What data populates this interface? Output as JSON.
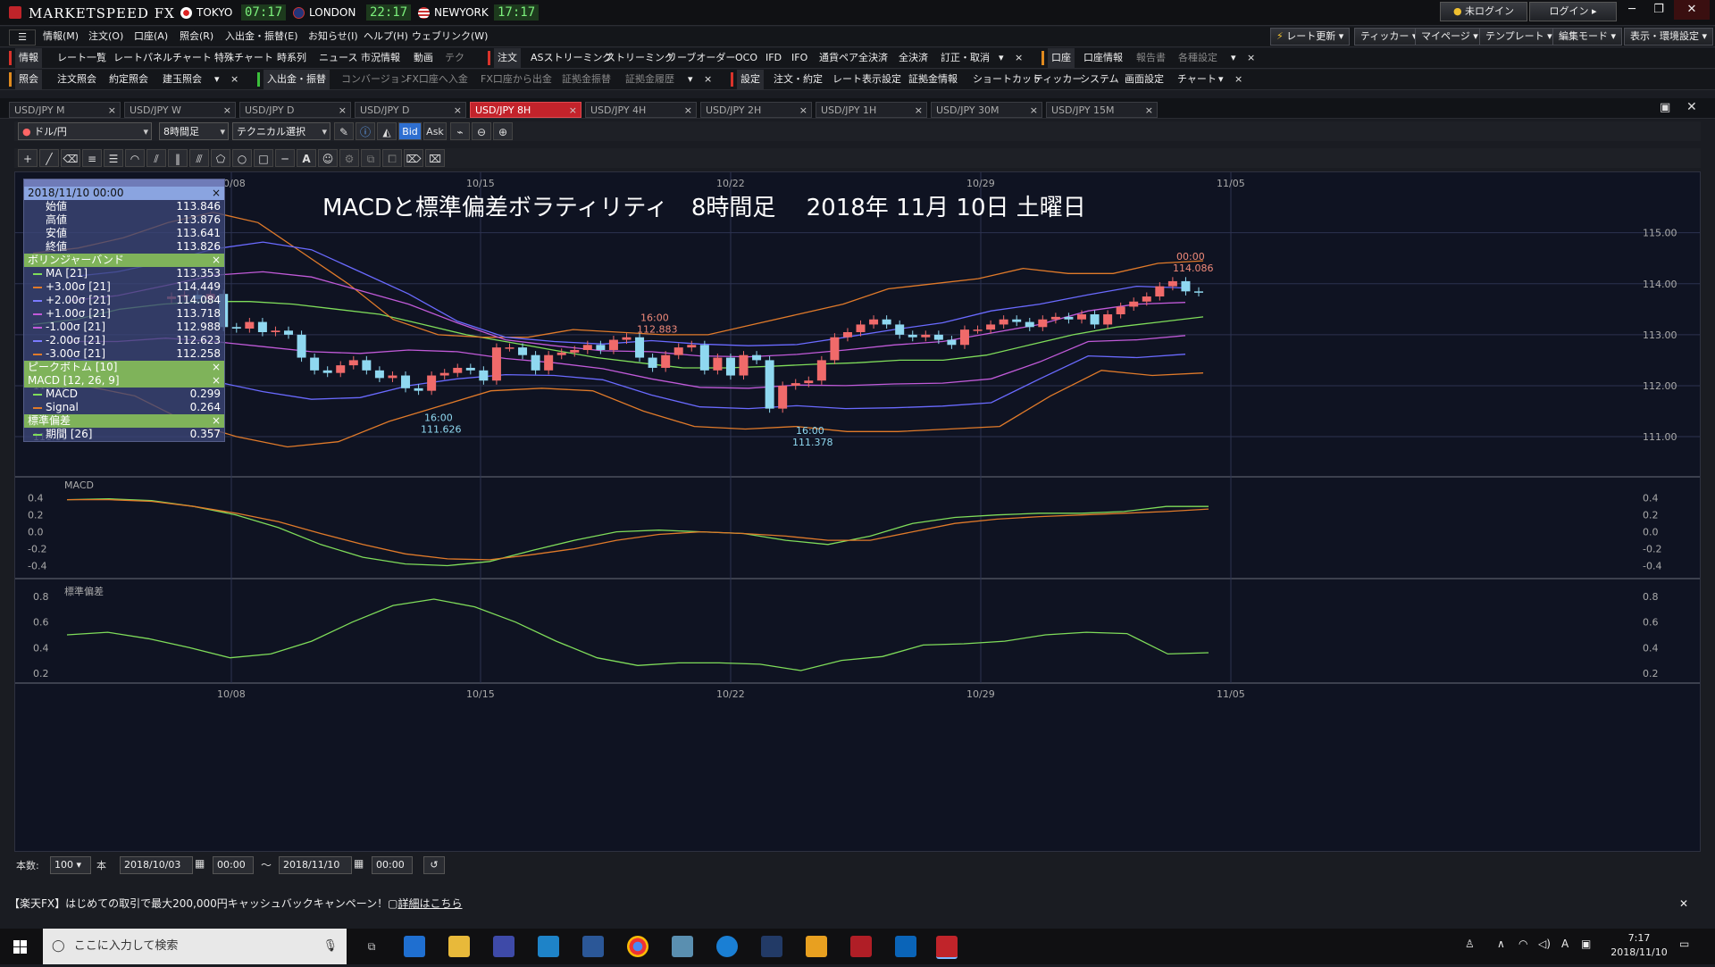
{
  "app": {
    "title": "MARKETSPEED FX"
  },
  "clocks": [
    {
      "city": "TOKYO",
      "time": "07:17"
    },
    {
      "city": "LONDON",
      "time": "22:17"
    },
    {
      "city": "NEWYORK",
      "time": "17:17"
    }
  ],
  "titlebar_right": {
    "login_status": "未ログイン",
    "login_button": "ログイン"
  },
  "menu_main": [
    "情報(M)",
    "注文(O)",
    "口座(A)",
    "照会(R)",
    "入出金・振替(E)",
    "お知らせ(I)",
    "ヘルプ(H)",
    "ウェブリンク(W)"
  ],
  "menu_main_right": [
    "レート更新",
    "ティッカー",
    "マイページ",
    "テンプレート",
    "編集モード",
    "表示・環境設定"
  ],
  "toolbar_row1_info": [
    "情報",
    "レート一覧",
    "レートパネル",
    "チャート",
    "特殊チャート",
    "時系列",
    "ニュース",
    "市況情報",
    "動画",
    "テク"
  ],
  "toolbar_row1_order": [
    "注文",
    "ASストリーミング",
    "ストリーミング",
    "リーブオーダー",
    "OCO",
    "IFD",
    "IFO",
    "通貨ペア全決済",
    "全決済",
    "訂正・取消"
  ],
  "toolbar_row1_account": [
    "口座",
    "口座情報",
    "報告書",
    "各種設定"
  ],
  "toolbar_row2_inquiry": [
    "照会",
    "注文照会",
    "約定照会",
    "建玉照会"
  ],
  "toolbar_row2_transfer": [
    "入出金・振替",
    "コンバージョン",
    "FX口座へ入金",
    "FX口座から出金",
    "証拠金振替",
    "証拠金履歴"
  ],
  "toolbar_row2_settings": [
    "設定",
    "注文・約定",
    "レート表示設定",
    "証拠金情報",
    "ショートカット",
    "ティッカー",
    "システム",
    "画面設定",
    "チャート"
  ],
  "chart_tabs": [
    "USD/JPY M",
    "USD/JPY W",
    "USD/JPY D",
    "USD/JPY 8H",
    "USD/JPY 4H",
    "USD/JPY 2H",
    "USD/JPY 1H",
    "USD/JPY 30M",
    "USD/JPY 15M"
  ],
  "active_tab": "USD/JPY 8H",
  "chart_toolbar": {
    "pair": "ドル/円",
    "period": "8時間足",
    "technical": "テクニカル選択",
    "bid": "Bid",
    "ask": "Ask"
  },
  "info_panel": {
    "date": "2018/11/10 00:00",
    "ohlc": [
      {
        "label": "始値",
        "value": "113.846"
      },
      {
        "label": "高値",
        "value": "113.876"
      },
      {
        "label": "安値",
        "value": "113.641"
      },
      {
        "label": "終値",
        "value": "113.826"
      }
    ],
    "bollinger_header": "ボリンジャーバンド",
    "bollinger": [
      {
        "label": "MA [21]",
        "value": "113.353",
        "color": "#7fdc5a"
      },
      {
        "label": "+3.00σ [21]",
        "value": "114.449",
        "color": "#e07a2a"
      },
      {
        "label": "+2.00σ [21]",
        "value": "114.084",
        "color": "#7b7bff"
      },
      {
        "label": "+1.00σ [21]",
        "value": "113.718",
        "color": "#c05ad8"
      },
      {
        "label": "-1.00σ [21]",
        "value": "112.988",
        "color": "#c05ad8"
      },
      {
        "label": "-2.00σ [21]",
        "value": "112.623",
        "color": "#7b7bff"
      },
      {
        "label": "-3.00σ [21]",
        "value": "112.258",
        "color": "#e07a2a"
      }
    ],
    "peak_header": "ピークボトム [10]",
    "macd_header": "MACD [12, 26, 9]",
    "macd": [
      {
        "label": "MACD",
        "value": "0.299",
        "color": "#7fdc5a"
      },
      {
        "label": "Signal",
        "value": "0.264",
        "color": "#e07a2a"
      }
    ],
    "stdev_header": "標準偏差",
    "stdev": [
      {
        "label": "期間 [26]",
        "value": "0.357",
        "color": "#7fdc5a"
      }
    ],
    "close_glyph": "×"
  },
  "chart_title": "MACDと標準偏差ボラティリティ　8時間足　 2018年 11月 10日 土曜日",
  "chart_data": [
    {
      "type": "candlestick",
      "title": "MACDと標準偏差ボラティリティ　8時間足　 2018年 11月 10日 土曜日",
      "x_tick_labels": [
        "10/08",
        "10/15",
        "10/22",
        "10/29",
        "11/05"
      ],
      "y_tick_labels": [
        "115.00",
        "114.00",
        "113.00",
        "112.00",
        "111.00"
      ],
      "ylim": [
        110.3,
        115.8
      ],
      "annotations": [
        {
          "time": "16:00",
          "price": "111.626"
        },
        {
          "time": "16:00",
          "price": "112.883"
        },
        {
          "time": "16:00",
          "price": "111.378"
        },
        {
          "time": "00:00",
          "price": "114.086"
        }
      ],
      "candles_close": [
        113.75,
        113.78,
        113.7,
        113.8,
        113.15,
        113.12,
        113.25,
        113.05,
        113.08,
        113.0,
        112.55,
        112.3,
        112.25,
        112.4,
        112.5,
        112.3,
        112.15,
        112.2,
        111.95,
        111.9,
        112.2,
        112.25,
        112.35,
        112.3,
        112.1,
        112.75,
        112.75,
        112.6,
        112.3,
        112.6,
        112.65,
        112.7,
        112.8,
        112.7,
        112.9,
        112.95,
        112.55,
        112.35,
        112.6,
        112.75,
        112.8,
        112.3,
        112.55,
        112.2,
        112.6,
        112.5,
        111.55,
        112.0,
        112.05,
        112.1,
        112.5,
        112.95,
        113.05,
        113.2,
        113.3,
        113.2,
        113.0,
        112.95,
        113.0,
        112.9,
        112.8,
        113.1,
        113.1,
        113.2,
        113.3,
        113.25,
        113.15,
        113.3,
        113.35,
        113.3,
        113.4,
        113.2,
        113.4,
        113.55,
        113.65,
        113.75,
        113.95,
        114.05,
        113.85,
        113.83
      ],
      "series": [
        {
          "name": "MA [21]",
          "color": "#7fdc5a",
          "values": [
            113.2,
            113.3,
            113.5,
            113.6,
            113.65,
            113.65,
            113.6,
            113.5,
            113.4,
            113.2,
            113.0,
            112.85,
            112.7,
            112.55,
            112.45,
            112.35,
            112.35,
            112.38,
            112.42,
            112.45,
            112.5,
            112.5,
            112.6,
            112.8,
            113.0,
            113.15,
            113.25,
            113.35
          ]
        },
        {
          "name": "+3.00σ [21]",
          "color": "#e07a2a",
          "values": [
            114.6,
            114.7,
            114.9,
            115.2,
            115.4,
            115.2,
            114.6,
            114.0,
            113.3,
            113.0,
            112.95,
            112.95,
            113.1,
            113.05,
            113.0,
            113.0,
            113.2,
            113.4,
            113.6,
            113.9,
            114.0,
            114.1,
            114.3,
            114.2,
            114.2,
            114.4,
            114.45
          ]
        },
        {
          "name": "-3.00σ [21]",
          "color": "#e07a2a",
          "values": [
            112.2,
            112.0,
            111.8,
            111.3,
            111.0,
            110.8,
            110.9,
            111.3,
            111.6,
            111.9,
            111.95,
            111.9,
            111.5,
            111.2,
            111.15,
            111.2,
            111.1,
            111.1,
            111.15,
            111.2,
            111.8,
            112.3,
            112.2,
            112.25
          ]
        }
      ]
    },
    {
      "type": "line",
      "title": "MACD",
      "y_tick_labels": [
        "0.4",
        "0.2",
        "0.0",
        "-0.2",
        "-0.4"
      ],
      "ylim": [
        -0.5,
        0.45
      ],
      "series": [
        {
          "name": "MACD",
          "color": "#7fdc5a",
          "values": [
            0.38,
            0.39,
            0.37,
            0.3,
            0.2,
            0.05,
            -0.15,
            -0.3,
            -0.38,
            -0.4,
            -0.35,
            -0.22,
            -0.1,
            0.0,
            0.02,
            0.0,
            -0.02,
            -0.1,
            -0.15,
            -0.05,
            0.1,
            0.17,
            0.2,
            0.22,
            0.22,
            0.24,
            0.3,
            0.3
          ]
        },
        {
          "name": "Signal",
          "color": "#e07a2a",
          "values": [
            0.38,
            0.38,
            0.36,
            0.3,
            0.22,
            0.12,
            -0.02,
            -0.15,
            -0.26,
            -0.32,
            -0.33,
            -0.27,
            -0.2,
            -0.1,
            -0.03,
            0.0,
            -0.02,
            -0.05,
            -0.1,
            -0.1,
            0.0,
            0.1,
            0.15,
            0.18,
            0.2,
            0.22,
            0.24,
            0.27
          ]
        }
      ]
    },
    {
      "type": "line",
      "title": "標準偏差",
      "y_tick_labels": [
        "0.8",
        "0.6",
        "0.4",
        "0.2"
      ],
      "ylim": [
        0.15,
        0.85
      ],
      "series": [
        {
          "name": "期間 [26]",
          "color": "#7fdc5a",
          "values": [
            0.5,
            0.52,
            0.47,
            0.4,
            0.32,
            0.35,
            0.45,
            0.6,
            0.73,
            0.78,
            0.72,
            0.6,
            0.45,
            0.32,
            0.26,
            0.28,
            0.28,
            0.27,
            0.22,
            0.3,
            0.33,
            0.42,
            0.43,
            0.45,
            0.5,
            0.52,
            0.51,
            0.35,
            0.36
          ]
        }
      ]
    }
  ],
  "range_bar": {
    "count_label": "本数:",
    "count": "100",
    "unit": "本",
    "from_date": "2018/10/03",
    "from_time": "00:00",
    "tilde": "〜",
    "to_date": "2018/11/10",
    "to_time": "00:00"
  },
  "campaign": {
    "text": "【楽天FX】はじめての取引で最大200,000円キャッシュバックキャンペーン！",
    "link": "詳細はこちら"
  },
  "taskbar": {
    "search_placeholder": "ここに入力して検索",
    "time": "7:17",
    "date": "2018/11/10"
  }
}
